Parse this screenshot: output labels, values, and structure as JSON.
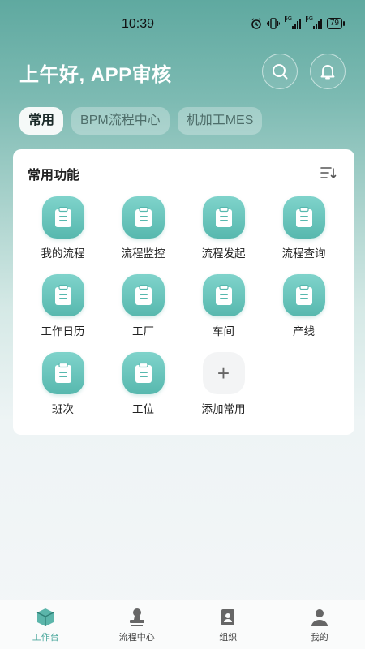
{
  "status_bar": {
    "time": "10:39",
    "battery": "79",
    "network": "5G"
  },
  "header": {
    "greeting": "上午好, APP审核",
    "search_icon": "search-icon",
    "bell_icon": "bell-icon"
  },
  "tabs": [
    {
      "label": "常用",
      "active": true
    },
    {
      "label": "BPM流程中心",
      "active": false
    },
    {
      "label": "机加工MES",
      "active": false
    }
  ],
  "common_functions": {
    "title": "常用功能",
    "sort_icon": "sort-icon",
    "items": [
      {
        "label": "我的流程",
        "icon": "clipboard-icon"
      },
      {
        "label": "流程监控",
        "icon": "clipboard-icon"
      },
      {
        "label": "流程发起",
        "icon": "clipboard-icon"
      },
      {
        "label": "流程查询",
        "icon": "clipboard-icon"
      },
      {
        "label": "工作日历",
        "icon": "clipboard-icon"
      },
      {
        "label": "工厂",
        "icon": "clipboard-icon"
      },
      {
        "label": "车间",
        "icon": "clipboard-icon"
      },
      {
        "label": "产线",
        "icon": "clipboard-icon"
      },
      {
        "label": "班次",
        "icon": "clipboard-icon"
      },
      {
        "label": "工位",
        "icon": "clipboard-icon"
      }
    ],
    "add": {
      "label": "添加常用",
      "symbol": "+"
    }
  },
  "bottom_nav": [
    {
      "label": "工作台",
      "icon": "cube-icon",
      "active": true
    },
    {
      "label": "流程中心",
      "icon": "stamp-icon",
      "active": false
    },
    {
      "label": "组织",
      "icon": "organization-icon",
      "active": false
    },
    {
      "label": "我的",
      "icon": "person-icon",
      "active": false
    }
  ],
  "colors": {
    "accent": "#4aa79c",
    "tile_top": "#7fd3cb",
    "tile_bottom": "#57b8ae"
  }
}
